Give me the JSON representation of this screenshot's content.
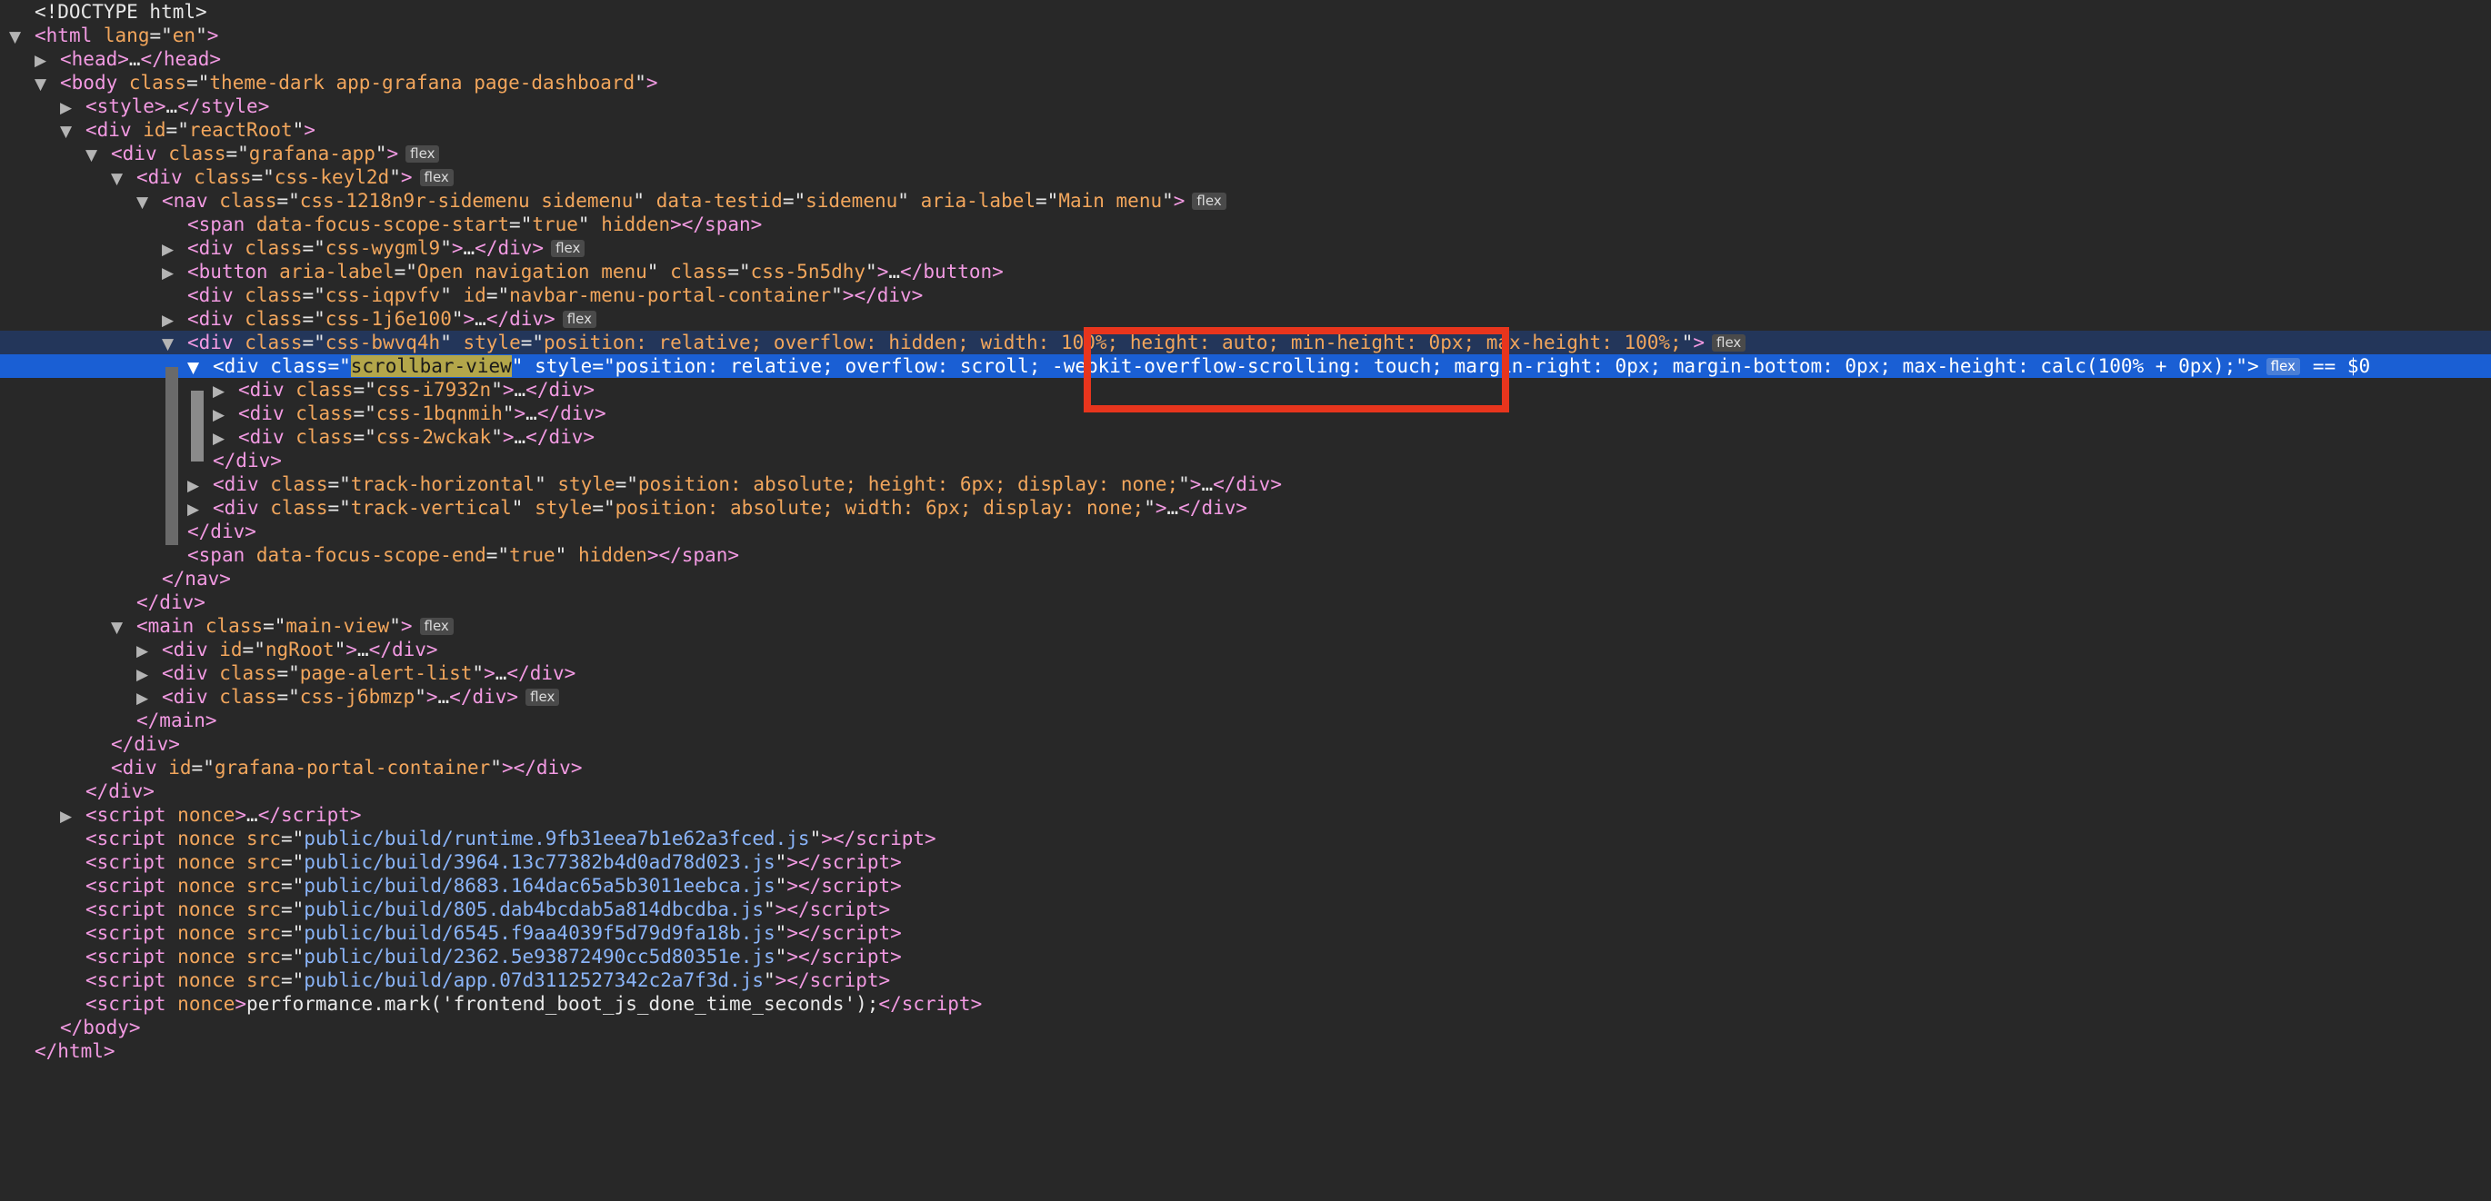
{
  "devtools": {
    "selected_suffix": "== $0",
    "badge_label": "flex",
    "nodes": [
      {
        "indent": 0,
        "arrow": "",
        "type": "doctype",
        "text": "<!DOCTYPE html>"
      },
      {
        "indent": 0,
        "arrow": "open",
        "type": "open",
        "tag": "html",
        "attrs": [
          {
            "name": "lang",
            "value": "en"
          }
        ],
        "tail": ""
      },
      {
        "indent": 1,
        "arrow": "closed",
        "type": "collapsed",
        "tag": "head",
        "attrs": []
      },
      {
        "indent": 1,
        "arrow": "open",
        "type": "open",
        "tag": "body",
        "attrs": [
          {
            "name": "class",
            "value": "theme-dark app-grafana page-dashboard"
          }
        ],
        "tail": ""
      },
      {
        "indent": 2,
        "arrow": "closed",
        "type": "collapsed",
        "tag": "style",
        "attrs": []
      },
      {
        "indent": 2,
        "arrow": "open",
        "type": "open",
        "tag": "div",
        "attrs": [
          {
            "name": "id",
            "value": "reactRoot"
          }
        ],
        "tail": ""
      },
      {
        "indent": 3,
        "arrow": "open",
        "type": "open",
        "tag": "div",
        "attrs": [
          {
            "name": "class",
            "value": "grafana-app"
          }
        ],
        "badge": true
      },
      {
        "indent": 4,
        "arrow": "open",
        "type": "open",
        "tag": "div",
        "attrs": [
          {
            "name": "class",
            "value": "css-keyl2d"
          }
        ],
        "badge": true
      },
      {
        "indent": 5,
        "arrow": "open",
        "type": "open",
        "tag": "nav",
        "attrs": [
          {
            "name": "class",
            "value": "css-1218n9r-sidemenu sidemenu"
          },
          {
            "name": "data-testid",
            "value": "sidemenu"
          },
          {
            "name": "aria-label",
            "value": "Main menu"
          }
        ],
        "badge": true
      },
      {
        "indent": 6,
        "arrow": "",
        "type": "inline",
        "tag": "span",
        "attrs": [
          {
            "name": "data-focus-scope-start",
            "value": "true"
          },
          {
            "name": "hidden",
            "value": null
          }
        ],
        "close": "span"
      },
      {
        "indent": 6,
        "arrow": "closed",
        "type": "collapsed",
        "tag": "div",
        "attrs": [
          {
            "name": "class",
            "value": "css-wygml9"
          }
        ],
        "badge": true
      },
      {
        "indent": 6,
        "arrow": "closed",
        "type": "collapsed",
        "tag": "button",
        "attrs": [
          {
            "name": "aria-label",
            "value": "Open navigation menu"
          },
          {
            "name": "class",
            "value": "css-5n5dhy"
          }
        ]
      },
      {
        "indent": 6,
        "arrow": "",
        "type": "inline",
        "tag": "div",
        "attrs": [
          {
            "name": "class",
            "value": "css-iqpvfv"
          },
          {
            "name": "id",
            "value": "navbar-menu-portal-container"
          }
        ],
        "close": "div"
      },
      {
        "indent": 6,
        "arrow": "closed",
        "type": "collapsed",
        "tag": "div",
        "attrs": [
          {
            "name": "class",
            "value": "css-1j6e100"
          }
        ],
        "badge": true
      },
      {
        "indent": 6,
        "arrow": "open",
        "type": "open",
        "tag": "div",
        "attrs": [
          {
            "name": "class",
            "value": "css-bwvq4h"
          },
          {
            "name": "style",
            "value": "position: relative; overflow: hidden; width: 100%; height: auto; min-height: 0px; max-height: 100%;"
          }
        ],
        "badge": true,
        "state": "hl-parent"
      },
      {
        "indent": 7,
        "arrow": "open",
        "type": "open",
        "tag": "div",
        "attrs": [
          {
            "name": "class",
            "value": "scrollbar-view",
            "mark": true
          },
          {
            "name": "style",
            "value": "position: relative; overflow: scroll; -webkit-overflow-scrolling: touch; margin-right: 0px; margin-bottom: 0px; max-height: calc(100% + 0px);"
          }
        ],
        "badge": true,
        "state": "selected"
      },
      {
        "indent": 8,
        "arrow": "closed",
        "type": "collapsed",
        "tag": "div",
        "attrs": [
          {
            "name": "class",
            "value": "css-i7932n"
          }
        ]
      },
      {
        "indent": 8,
        "arrow": "closed",
        "type": "collapsed",
        "tag": "div",
        "attrs": [
          {
            "name": "class",
            "value": "css-1bqnmih"
          }
        ]
      },
      {
        "indent": 8,
        "arrow": "closed",
        "type": "collapsed",
        "tag": "div",
        "attrs": [
          {
            "name": "class",
            "value": "css-2wckak"
          }
        ]
      },
      {
        "indent": 7,
        "arrow": "",
        "type": "close",
        "tag": "div"
      },
      {
        "indent": 7,
        "arrow": "closed",
        "type": "collapsed",
        "tag": "div",
        "attrs": [
          {
            "name": "class",
            "value": "track-horizontal"
          },
          {
            "name": "style",
            "value": "position: absolute; height: 6px; display: none;"
          }
        ]
      },
      {
        "indent": 7,
        "arrow": "closed",
        "type": "collapsed",
        "tag": "div",
        "attrs": [
          {
            "name": "class",
            "value": "track-vertical"
          },
          {
            "name": "style",
            "value": "position: absolute; width: 6px; display: none;"
          }
        ]
      },
      {
        "indent": 6,
        "arrow": "",
        "type": "close",
        "tag": "div"
      },
      {
        "indent": 6,
        "arrow": "",
        "type": "inline",
        "tag": "span",
        "attrs": [
          {
            "name": "data-focus-scope-end",
            "value": "true"
          },
          {
            "name": "hidden",
            "value": null
          }
        ],
        "close": "span"
      },
      {
        "indent": 5,
        "arrow": "",
        "type": "close",
        "tag": "nav"
      },
      {
        "indent": 4,
        "arrow": "",
        "type": "close",
        "tag": "div"
      },
      {
        "indent": 4,
        "arrow": "open",
        "type": "open",
        "tag": "main",
        "attrs": [
          {
            "name": "class",
            "value": "main-view"
          }
        ],
        "badge": true
      },
      {
        "indent": 5,
        "arrow": "closed",
        "type": "collapsed",
        "tag": "div",
        "attrs": [
          {
            "name": "id",
            "value": "ngRoot"
          }
        ]
      },
      {
        "indent": 5,
        "arrow": "closed",
        "type": "collapsed",
        "tag": "div",
        "attrs": [
          {
            "name": "class",
            "value": "page-alert-list"
          }
        ]
      },
      {
        "indent": 5,
        "arrow": "closed",
        "type": "collapsed",
        "tag": "div",
        "attrs": [
          {
            "name": "class",
            "value": "css-j6bmzp"
          }
        ],
        "badge": true
      },
      {
        "indent": 4,
        "arrow": "",
        "type": "close",
        "tag": "main"
      },
      {
        "indent": 3,
        "arrow": "",
        "type": "close",
        "tag": "div"
      },
      {
        "indent": 3,
        "arrow": "",
        "type": "inline",
        "tag": "div",
        "attrs": [
          {
            "name": "id",
            "value": "grafana-portal-container"
          }
        ],
        "close": "div"
      },
      {
        "indent": 2,
        "arrow": "",
        "type": "close",
        "tag": "div"
      },
      {
        "indent": 2,
        "arrow": "closed",
        "type": "collapsed",
        "tag": "script",
        "attrs": [
          {
            "name": "nonce",
            "value": null
          }
        ]
      },
      {
        "indent": 2,
        "arrow": "",
        "type": "inline",
        "tag": "script",
        "attrs": [
          {
            "name": "nonce",
            "value": null
          },
          {
            "name": "src",
            "value": "public/build/runtime.9fb31eea7b1e62a3fced.js",
            "link": true
          }
        ],
        "close": "script"
      },
      {
        "indent": 2,
        "arrow": "",
        "type": "inline",
        "tag": "script",
        "attrs": [
          {
            "name": "nonce",
            "value": null
          },
          {
            "name": "src",
            "value": "public/build/3964.13c77382b4d0ad78d023.js",
            "link": true
          }
        ],
        "close": "script"
      },
      {
        "indent": 2,
        "arrow": "",
        "type": "inline",
        "tag": "script",
        "attrs": [
          {
            "name": "nonce",
            "value": null
          },
          {
            "name": "src",
            "value": "public/build/8683.164dac65a5b3011eebca.js",
            "link": true
          }
        ],
        "close": "script"
      },
      {
        "indent": 2,
        "arrow": "",
        "type": "inline",
        "tag": "script",
        "attrs": [
          {
            "name": "nonce",
            "value": null
          },
          {
            "name": "src",
            "value": "public/build/805.dab4bcdab5a814dbcdba.js",
            "link": true
          }
        ],
        "close": "script"
      },
      {
        "indent": 2,
        "arrow": "",
        "type": "inline",
        "tag": "script",
        "attrs": [
          {
            "name": "nonce",
            "value": null
          },
          {
            "name": "src",
            "value": "public/build/6545.f9aa4039f5d79d9fa18b.js",
            "link": true
          }
        ],
        "close": "script"
      },
      {
        "indent": 2,
        "arrow": "",
        "type": "inline",
        "tag": "script",
        "attrs": [
          {
            "name": "nonce",
            "value": null
          },
          {
            "name": "src",
            "value": "public/build/2362.5e93872490cc5d80351e.js",
            "link": true
          }
        ],
        "close": "script"
      },
      {
        "indent": 2,
        "arrow": "",
        "type": "inline",
        "tag": "script",
        "attrs": [
          {
            "name": "nonce",
            "value": null
          },
          {
            "name": "src",
            "value": "public/build/app.07d3112527342c2a7f3d.js",
            "link": true
          }
        ],
        "close": "script"
      },
      {
        "indent": 2,
        "arrow": "",
        "type": "inline",
        "tag": "script",
        "attrs": [
          {
            "name": "nonce",
            "value": null
          }
        ],
        "content": "performance.mark('frontend_boot_js_done_time_seconds');",
        "close": "script"
      },
      {
        "indent": 1,
        "arrow": "",
        "type": "close",
        "tag": "body"
      },
      {
        "indent": 0,
        "arrow": "",
        "type": "close",
        "tag": "html"
      }
    ]
  },
  "annotation": {
    "highlighted_text": "-webkit-overflow-scrolling: touch;",
    "color": "#e8351d"
  },
  "colors": {
    "background": "#282828",
    "tag": "#f29ae2",
    "attribute": "#f2a65c",
    "link": "#8ab4f8",
    "selected_row": "#1a5fd4",
    "parent_row": "#23365a"
  }
}
